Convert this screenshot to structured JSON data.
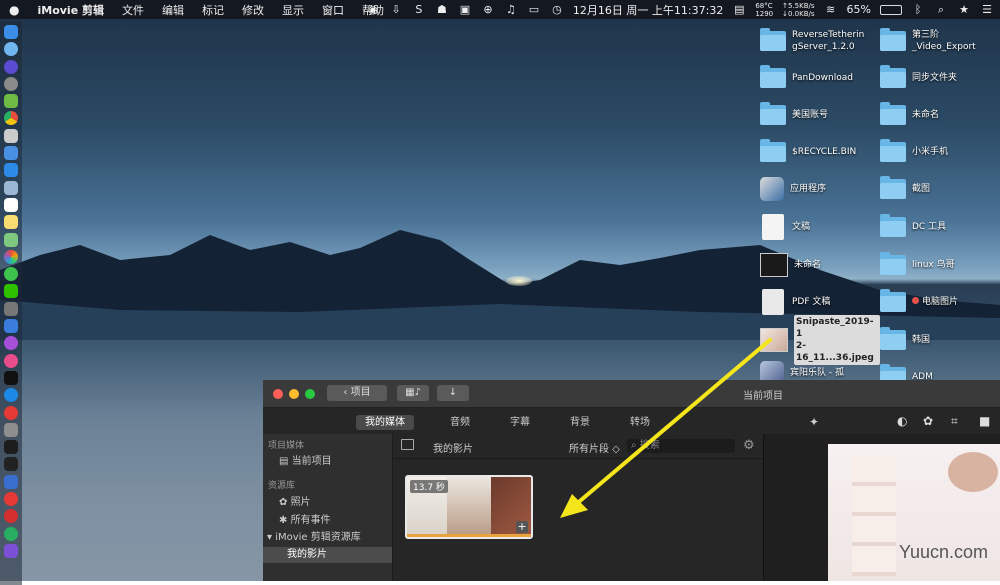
{
  "menubar": {
    "app": "iMovie 剪辑",
    "items": [
      "文件",
      "编辑",
      "标记",
      "修改",
      "显示",
      "窗口",
      "帮助"
    ],
    "temp": "68°C",
    "fan": "1290",
    "net_up": "↑5.5KB/s",
    "net_down": "↓0.0KB/s",
    "datetime": "12月16日 周一 上午11:37:32",
    "battery": "65%"
  },
  "desktop_icons": [
    {
      "label": "ReverseTetheringServer_1.2.0",
      "kind": "folder",
      "line1": "ReverseTetherin",
      "line2": "gServer_1.2.0"
    },
    {
      "label": "第三阶_Video_Export",
      "kind": "folder",
      "line1": "第三阶",
      "line2": "_Video_Export"
    },
    {
      "label": "PanDownload",
      "kind": "folder"
    },
    {
      "label": "同步文件夹",
      "kind": "folder"
    },
    {
      "label": "美国账号",
      "kind": "folder"
    },
    {
      "label": "未命名",
      "kind": "folder"
    },
    {
      "label": "$RECYCLE.BIN",
      "kind": "folder"
    },
    {
      "label": "小米手机",
      "kind": "folder"
    },
    {
      "label": "应用程序",
      "kind": "app"
    },
    {
      "label": "截图",
      "kind": "folder"
    },
    {
      "label": "文稿",
      "kind": "file"
    },
    {
      "label": "DC 工具",
      "kind": "folder"
    },
    {
      "label": "未命名",
      "kind": "thumb"
    },
    {
      "label": "linux 鸟哥",
      "kind": "folder"
    },
    {
      "label": "PDF 文稿",
      "kind": "file"
    },
    {
      "label": "电脑图片",
      "kind": "folder",
      "tag_color": "#e5534b"
    },
    {
      "label": "Snipaste_2019-12-16_11...36.jpeg",
      "kind": "thumb",
      "line1": "Snipaste_2019-1",
      "line2": "2-16_11...36.jpeg"
    },
    {
      "label": "韩国",
      "kind": "folder"
    },
    {
      "label": "宾阳乐队 - 孤",
      "kind": "app"
    },
    {
      "label": "ADM",
      "kind": "folder"
    }
  ],
  "imovie": {
    "back_button": "项目",
    "window_title": "当前项目",
    "tabs": [
      "我的媒体",
      "音频",
      "字幕",
      "背景",
      "转场"
    ],
    "sidebar": {
      "section_project": "项目媒体",
      "current_project": "当前项目",
      "section_library": "资源库",
      "photos": "照片",
      "all_events": "所有事件",
      "library_name": "iMovie 剪辑资源库",
      "my_movies": "我的影片"
    },
    "browser": {
      "title": "我的影片",
      "filter": "所有片段 ◇",
      "search_placeholder": "搜索",
      "clip_duration": "13.7 秒"
    }
  },
  "colors": {
    "arrow": "#f5e51b",
    "accent": "#e8a33c"
  },
  "watermark": "Yuucn.com"
}
